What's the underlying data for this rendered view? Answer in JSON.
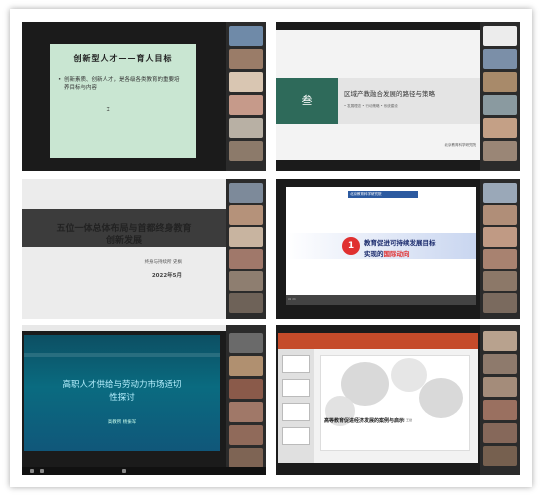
{
  "cells": [
    {
      "slide": {
        "title": "创新型人才——育人目标",
        "bullet": "创新素质、创新人才，是各级各类教育的重要培养目标与内容"
      }
    },
    {
      "slide": {
        "number": "叁",
        "title": "区域产教融合发展的路径与策略",
        "subtitle": "• 发展理念   • 行动策略   • 系统建设",
        "footer": "北京教育科学研究院"
      }
    },
    {
      "slide": {
        "title_line1": "五位一体总体布局与首都终身教育",
        "title_line2": "创新发展",
        "presenter": "终身与持续所   史枫",
        "date": "2022年5月"
      }
    },
    {
      "slide": {
        "logo": "北京教育科学研究院",
        "number": "1",
        "heading1": "教育促进可持续发展目标",
        "heading2_prefix": "实现的",
        "heading2_highlight": "国际动向"
      }
    },
    {
      "slide": {
        "title_line1": "高职人才供给与劳动力市场适切",
        "title_line2": "性探讨",
        "presenter": "高教所 杨振军"
      }
    },
    {
      "slide": {
        "caption": "高等教育促进经济发展的案例与启示",
        "author": "高教所 王健"
      }
    }
  ],
  "colors": {
    "meeting_bg": "#1b1b1b",
    "sidebar_bg": "#2b2b2b",
    "accent_red": "#e03030",
    "accent_teal": "#2e6a5a",
    "accent_blue": "#1a2a6c"
  }
}
